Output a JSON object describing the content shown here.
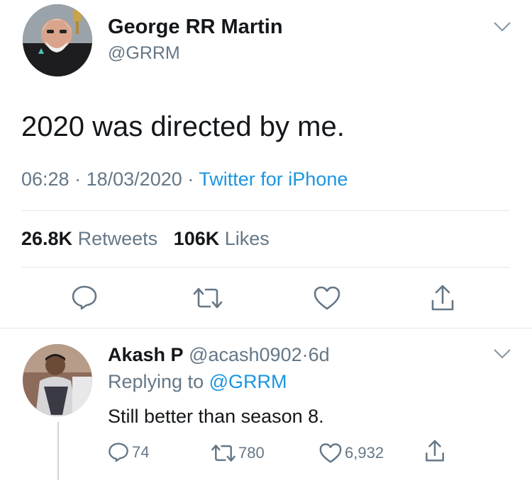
{
  "main_tweet": {
    "author_name": "George RR Martin",
    "author_handle": "@GRRM",
    "text": "2020 was directed by me.",
    "time": "06:28",
    "date": "18/03/2020",
    "source": "Twitter for iPhone",
    "separator": "·",
    "stats": {
      "retweets_count": "26.8K",
      "retweets_label": "Retweets",
      "likes_count": "106K",
      "likes_label": "Likes"
    },
    "actions": [
      "reply-icon",
      "retweet-icon",
      "like-icon",
      "share-icon"
    ]
  },
  "reply": {
    "author_name": "Akash P",
    "author_handle": "@acash0902",
    "separator": "·",
    "age": "6d",
    "replying_to_label": "Replying to",
    "replying_to_handle": "@GRRM",
    "text": "Still better than season 8.",
    "reply_count": "74",
    "retweet_count": "780",
    "like_count": "6,932"
  },
  "colors": {
    "text": "#14171a",
    "muted": "#657786",
    "link": "#1b95e0",
    "divider": "#e1e8ed"
  }
}
